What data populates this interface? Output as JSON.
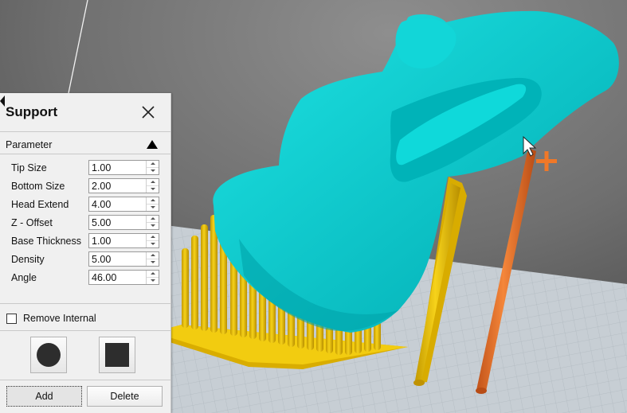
{
  "support_panel": {
    "title": "Support",
    "section": "Parameter",
    "parameters": [
      {
        "label": "Tip Size",
        "value": "1.00"
      },
      {
        "label": "Bottom Size",
        "value": "2.00"
      },
      {
        "label": "Head Extend",
        "value": "4.00"
      },
      {
        "label": "Z - Offset",
        "value": "5.00"
      },
      {
        "label": "Base Thickness",
        "value": "1.00"
      },
      {
        "label": "Density",
        "value": "5.00"
      },
      {
        "label": "Angle",
        "value": "46.00"
      }
    ],
    "remove_internal": {
      "label": "Remove Internal",
      "checked": false
    },
    "shapes": [
      {
        "name": "circle",
        "icon": "circle-icon"
      },
      {
        "name": "square",
        "icon": "square-icon"
      }
    ],
    "add_label": "Add",
    "delete_label": "Delete"
  },
  "viewport": {
    "model_color": "#00c8cc",
    "support_color": "#f0c800",
    "new_support_color": "#f07828",
    "bed_color": "#c9d0d6",
    "cursor_icon": "add-cursor-icon"
  }
}
